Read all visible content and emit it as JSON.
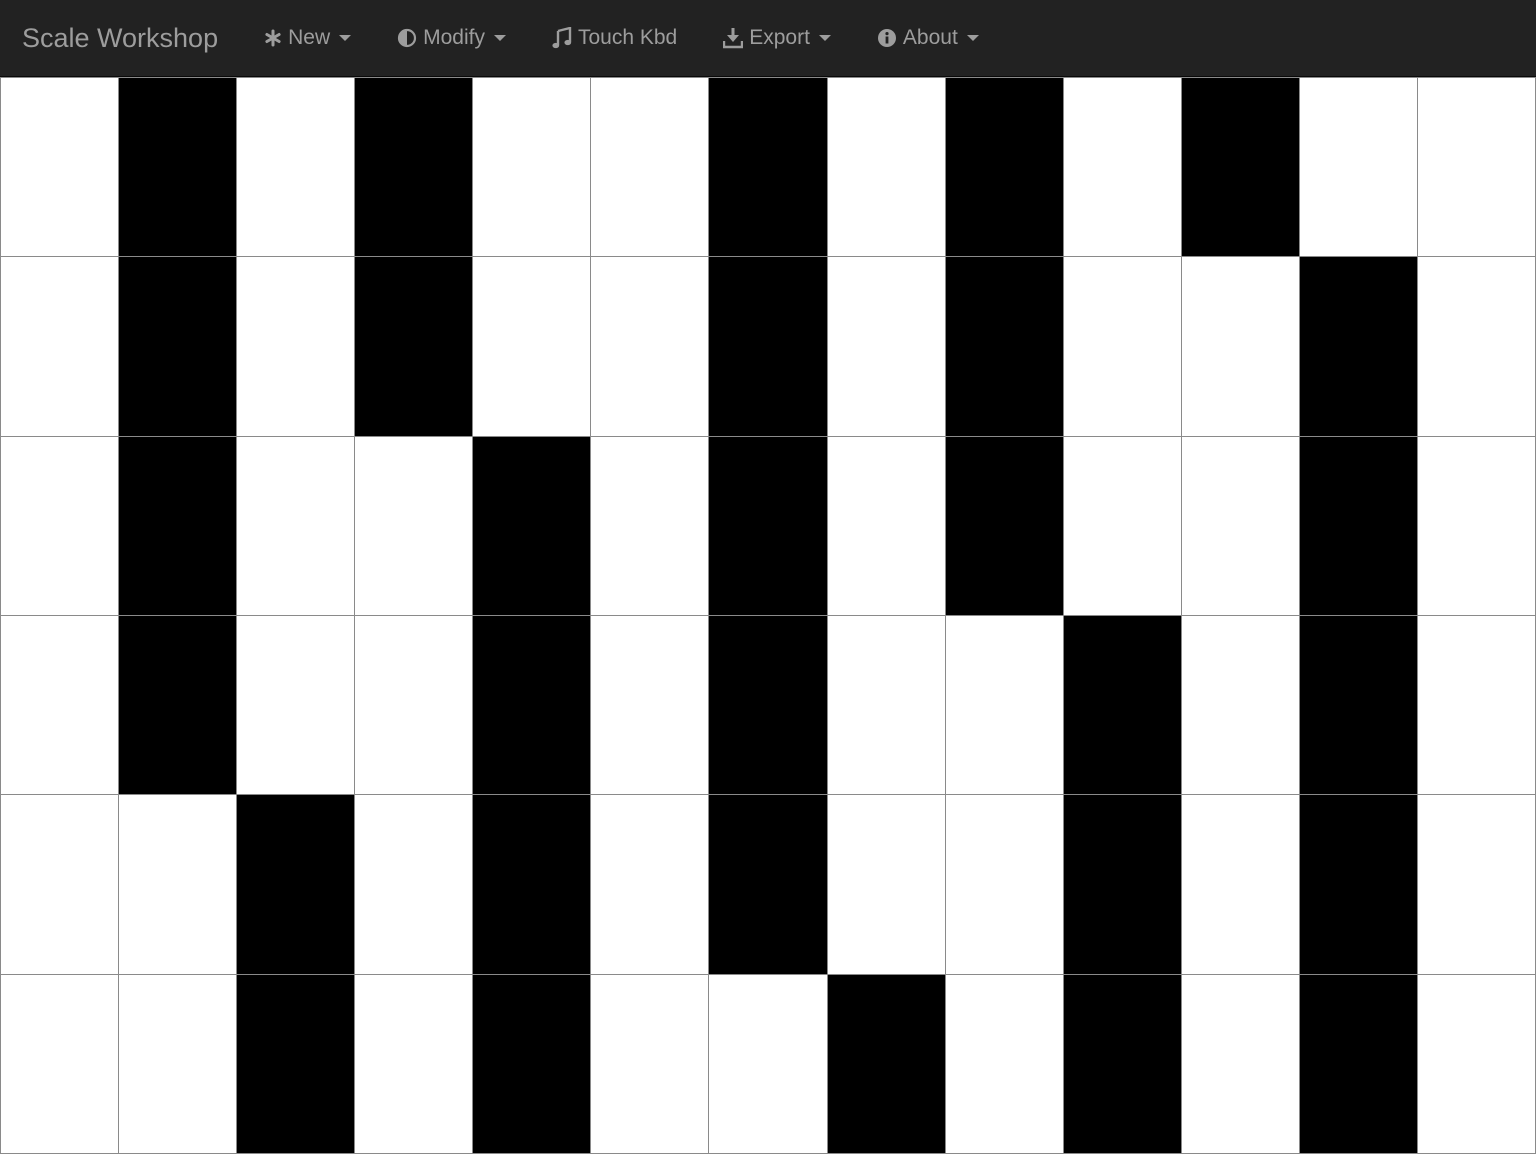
{
  "navbar": {
    "brand": "Scale Workshop",
    "items": [
      {
        "label": "New",
        "icon": "asterisk-icon",
        "dropdown": true
      },
      {
        "label": "Modify",
        "icon": "adjust-icon",
        "dropdown": true
      },
      {
        "label": "Touch Kbd",
        "icon": "music-note-icon",
        "dropdown": false
      },
      {
        "label": "Export",
        "icon": "download-icon",
        "dropdown": true
      },
      {
        "label": "About",
        "icon": "info-circle-icon",
        "dropdown": true
      }
    ]
  },
  "keyboard": {
    "columns": 13,
    "rows": [
      [
        0,
        1,
        0,
        1,
        0,
        0,
        1,
        0,
        1,
        0,
        1,
        0,
        0
      ],
      [
        0,
        1,
        0,
        1,
        0,
        0,
        1,
        0,
        1,
        0,
        0,
        1,
        0
      ],
      [
        0,
        1,
        0,
        0,
        1,
        0,
        1,
        0,
        1,
        0,
        0,
        1,
        0
      ],
      [
        0,
        1,
        0,
        0,
        1,
        0,
        1,
        0,
        0,
        1,
        0,
        1,
        0
      ],
      [
        0,
        0,
        1,
        0,
        1,
        0,
        1,
        0,
        0,
        1,
        0,
        1,
        0
      ],
      [
        0,
        0,
        1,
        0,
        1,
        0,
        0,
        1,
        0,
        1,
        0,
        1,
        0
      ]
    ]
  },
  "colors": {
    "navbar_bg": "#222222",
    "navbar_text": "#9d9d9d",
    "key_black": "#000000",
    "key_white": "#ffffff",
    "grid_line": "#8a8a8a"
  }
}
